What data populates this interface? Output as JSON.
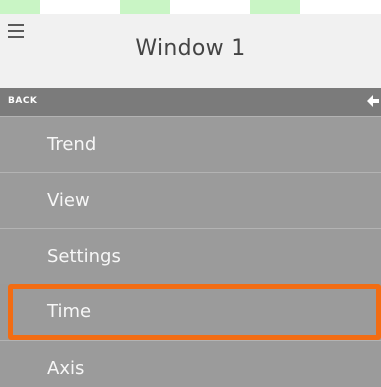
{
  "header": {
    "title": "Window 1",
    "menu_icon": "hamburger-icon"
  },
  "backbar": {
    "label": "BACK",
    "icon": "arrow-left-icon"
  },
  "menu": {
    "items": [
      {
        "label": "Trend"
      },
      {
        "label": "View"
      },
      {
        "label": "Settings"
      },
      {
        "label": "Time",
        "highlighted": true
      },
      {
        "label": "Axis"
      }
    ]
  },
  "colors": {
    "header_bg": "#f1f1f1",
    "backbar_bg": "#7b7b7b",
    "menu_bg": "#9b9b9b",
    "highlight": "#f26c13"
  }
}
